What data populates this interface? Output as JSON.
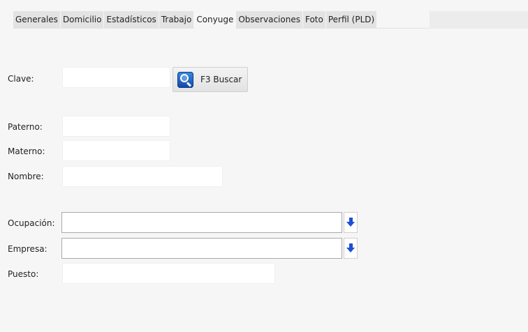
{
  "tabs": [
    {
      "label": "Generales"
    },
    {
      "label": "Domicilio"
    },
    {
      "label": "Estadísticos"
    },
    {
      "label": "Trabajo"
    },
    {
      "label": "Conyuge",
      "active": true
    },
    {
      "label": "Observaciones"
    },
    {
      "label": "Foto"
    },
    {
      "label": "Perfil (PLD)"
    }
  ],
  "form": {
    "clave": {
      "label": "Clave:",
      "value": ""
    },
    "search_button": {
      "label": "F3 Buscar",
      "icon": "magnifier-icon"
    },
    "paterno": {
      "label": "Paterno:",
      "value": ""
    },
    "materno": {
      "label": "Materno:",
      "value": ""
    },
    "nombre": {
      "label": "Nombre:",
      "value": ""
    },
    "ocupacion": {
      "label": "Ocupación:",
      "value": "",
      "dropdown_icon": "arrow-down-icon"
    },
    "empresa": {
      "label": "Empresa:",
      "value": "",
      "dropdown_icon": "arrow-down-icon"
    },
    "puesto": {
      "label": "Puesto:",
      "value": ""
    }
  },
  "colors": {
    "background": "#f6f6f6",
    "tab_inactive": "#e3e3e3",
    "arrow_blue": "#1d4fd6",
    "icon_blue": "#1247a8"
  }
}
